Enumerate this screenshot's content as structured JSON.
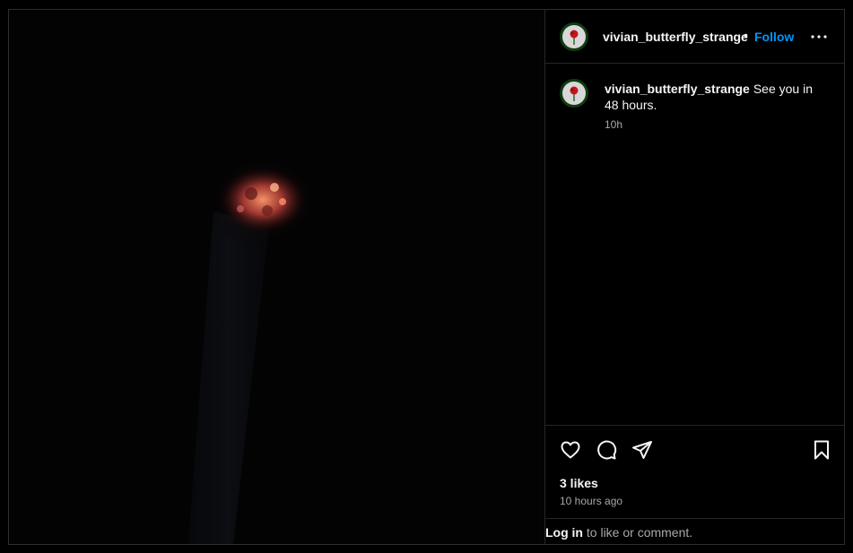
{
  "post": {
    "author": {
      "username": "vivian_butterfly_strange",
      "avatar_icon": "rose-avatar-icon"
    },
    "header": {
      "separator": "•",
      "follow_label": "Follow",
      "more_icon": "more-horizontal-icon"
    },
    "caption": {
      "username": "vivian_butterfly_strange",
      "text": "See you in 48 hours.",
      "time": "10h"
    },
    "actions": {
      "like_icon": "heart-icon",
      "comment_icon": "comment-icon",
      "share_icon": "share-icon",
      "save_icon": "bookmark-icon"
    },
    "likes": "3 likes",
    "timestamp": "10 hours ago",
    "login_prompt": {
      "link": "Log in",
      "rest": " to like or comment."
    }
  },
  "colors": {
    "background": "#000000",
    "accent": "#0095f6",
    "muted_text": "#a8a8a8",
    "divider": "#262626"
  }
}
